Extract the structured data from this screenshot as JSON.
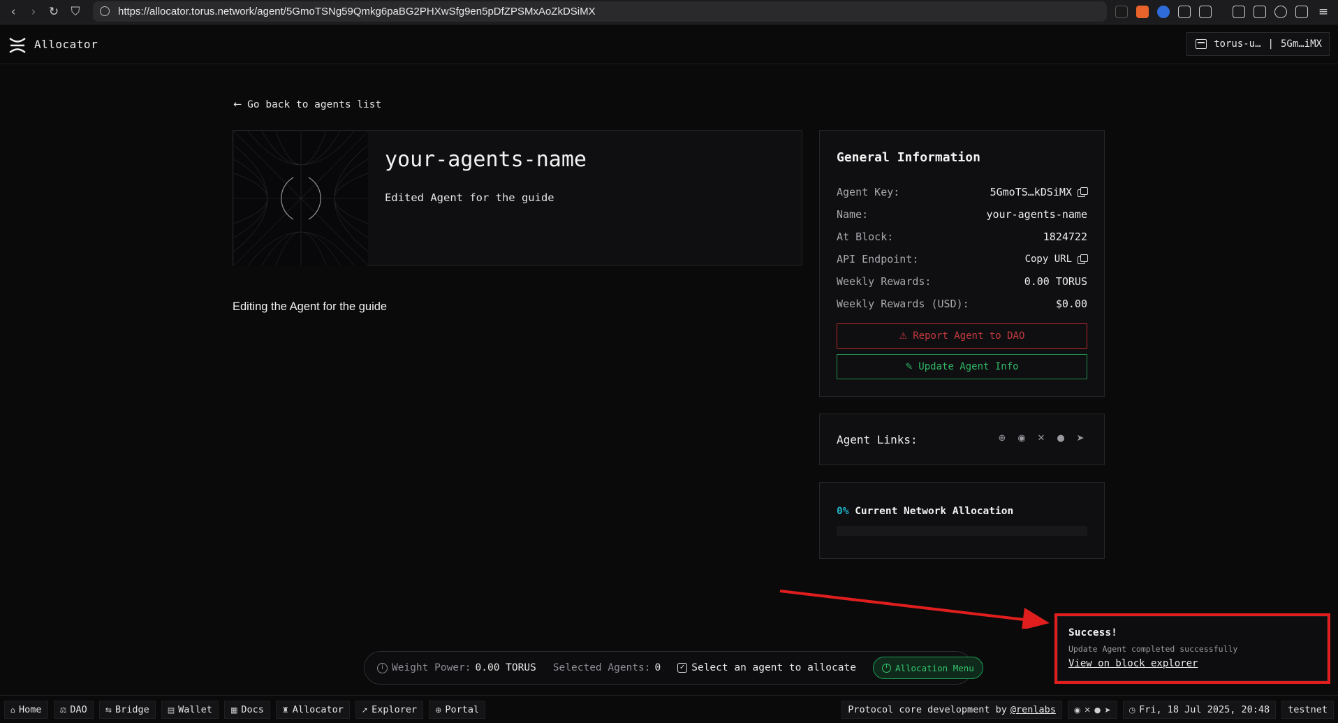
{
  "browser": {
    "url": "https://allocator.torus.network/agent/5GmoTSNg59Qmkg6paBG2PHXwSfg9en5pDfZPSMxAoZkDSiMX"
  },
  "header": {
    "app_title": "Allocator",
    "wallet_name": "torus-u…",
    "wallet_separator": "|",
    "wallet_address": "5Gm…iMX"
  },
  "nav": {
    "back_label": "Go back to agents list"
  },
  "agent": {
    "name": "your-agents-name",
    "short_description": "Edited Agent for the guide",
    "description": "Editing the Agent for the guide"
  },
  "general_info": {
    "title": "General Information",
    "rows": [
      {
        "label": "Agent Key:",
        "value": "5GmoTS…kDSiMX"
      },
      {
        "label": "Name:",
        "value": "your-agents-name"
      },
      {
        "label": "At Block:",
        "value": "1824722"
      },
      {
        "label": "API Endpoint:",
        "value": "Copy URL"
      },
      {
        "label": "Weekly Rewards:",
        "value": "0.00 TORUS"
      },
      {
        "label": "Weekly Rewards (USD):",
        "value": "$0.00"
      }
    ],
    "report_label": "Report Agent to DAO",
    "update_label": "Update Agent Info",
    "report_color": "#c53a3f",
    "update_color": "#2fb866"
  },
  "agent_links": {
    "title": "Agent Links:",
    "icons": [
      "globe-icon",
      "discord-icon",
      "x-icon",
      "github-icon",
      "telegram-icon"
    ]
  },
  "network_allocation": {
    "percent": "0%",
    "label": "Current Network Allocation",
    "fill_fraction": 0,
    "accent": "#1fb5c9"
  },
  "toast": {
    "title": "Success!",
    "message": "Update Agent completed successfully",
    "link": "View on block explorer"
  },
  "allocation_bar": {
    "weight_label": "Weight Power:",
    "weight_value": "0.00 TORUS",
    "selected_label": "Selected Agents:",
    "selected_value": "0",
    "select_prompt": "Select an agent to allocate",
    "menu_button": "Allocation Menu"
  },
  "footer": {
    "nav": [
      {
        "label": "Home",
        "icon": "home-icon"
      },
      {
        "label": "DAO",
        "icon": "dao-icon"
      },
      {
        "label": "Bridge",
        "icon": "bridge-icon"
      },
      {
        "label": "Wallet",
        "icon": "wallet-icon"
      },
      {
        "label": "Docs",
        "icon": "docs-icon"
      },
      {
        "label": "Allocator",
        "icon": "allocator-icon"
      },
      {
        "label": "Explorer",
        "icon": "explorer-icon"
      },
      {
        "label": "Portal",
        "icon": "portal-icon"
      }
    ],
    "credit_prefix": "Protocol core development by",
    "credit_link": "@renlabs",
    "datetime": "Fri, 18 Jul 2025, 20:48",
    "network": "testnet"
  }
}
